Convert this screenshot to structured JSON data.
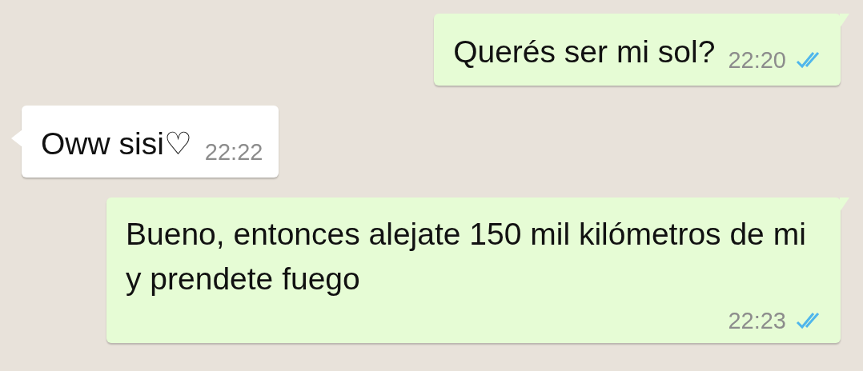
{
  "messages": [
    {
      "kind": "outgoing",
      "text": "Querés ser mi sol?",
      "time": "22:20",
      "read": true
    },
    {
      "kind": "incoming",
      "text": "Oww sisi♡",
      "time": "22:22"
    },
    {
      "kind": "outgoing",
      "text": "Bueno, entonces alejate 150 mil kilómetros de mi y prendete fuego",
      "time": "22:23",
      "read": true
    }
  ]
}
